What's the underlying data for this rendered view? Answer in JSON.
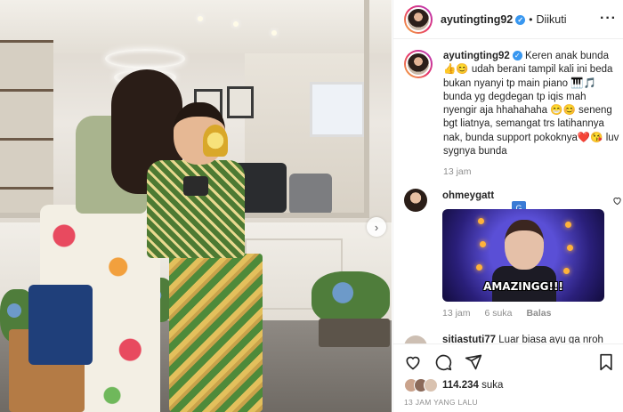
{
  "post": {
    "username": "ayutingting92",
    "follow_status": "Diikuti",
    "separator": "•",
    "more_label": "···"
  },
  "caption": {
    "username": "ayutingting92",
    "text": "Keren anak bunda 👍😊 udah berani tampil kali ini beda bukan nyanyi tp main piano 🎹🎵 bunda yg degdegan tp iqis mah nyengir aja hhahahaha 😁😊 seneng bgt liatnya, semangat trs latihannya nak, bunda support pokoknya❤️😘 luv sygnya bunda",
    "time": "13 jam"
  },
  "comments": [
    {
      "username": "ohmeygatt",
      "gif_caption": "AMAZINGG!!!",
      "time": "13 jam",
      "likes": "6 suka",
      "reply_label": "Balas"
    },
    {
      "username": "sitiastuti77",
      "text": "Luar biasa ayu ga nroh"
    }
  ],
  "actions": {
    "likes_count": "114.234",
    "likes_label": "suka",
    "time_ago": "13 JAM YANG LALU"
  },
  "icons": {
    "verified": "verified-badge-icon",
    "next": "chevron-right-icon",
    "like": "heart-icon",
    "comment": "comment-icon",
    "share": "send-icon",
    "save": "bookmark-icon",
    "translate": "translate-icon"
  },
  "colors": {
    "verified": "#3897f0",
    "muted_text": "#8e8e8e",
    "story_ring": "#e5326a"
  }
}
